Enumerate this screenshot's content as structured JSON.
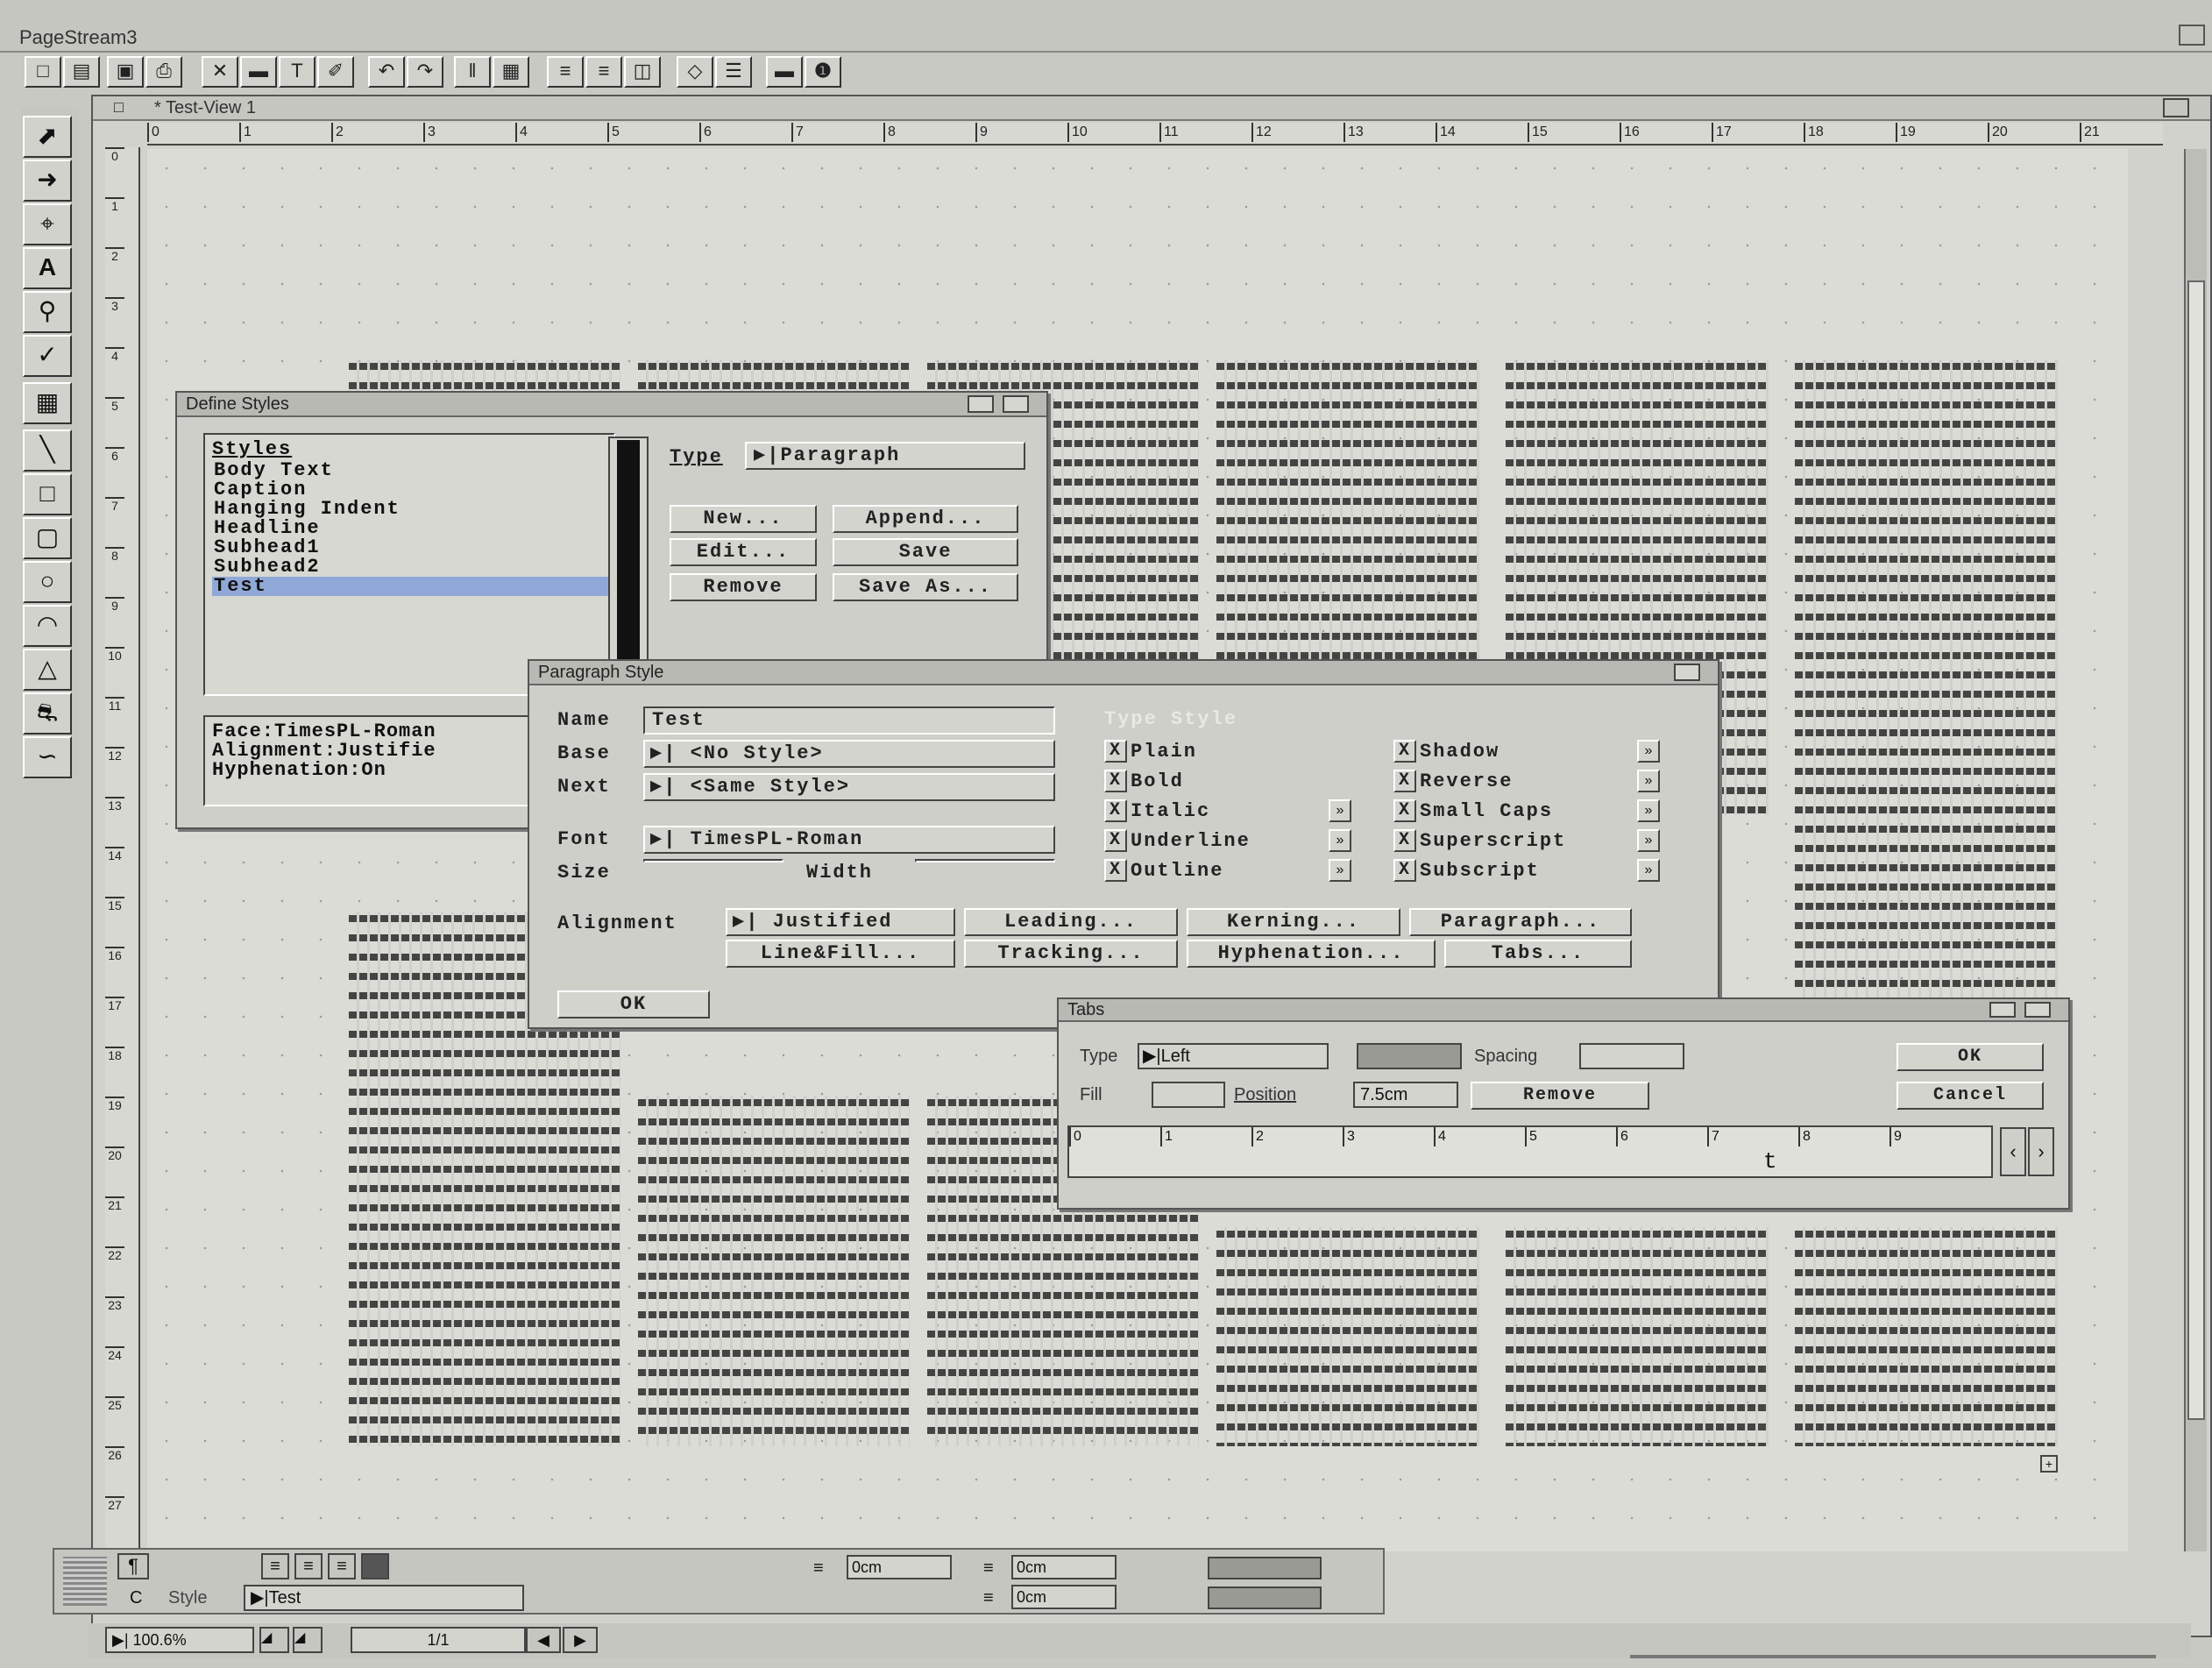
{
  "app": {
    "title": "PageStream3",
    "view_title": "* Test-View 1"
  },
  "toolbar": {
    "icons": [
      "new-document-icon",
      "open-icon",
      "save-icon",
      "print-icon",
      "cut-icon",
      "copy-icon",
      "paste-icon",
      "brush-icon",
      "undo-icon",
      "redo-icon",
      "columns-icon",
      "grid-icon",
      "align-left-icon",
      "align-center-icon",
      "align-right-icon",
      "select-icon",
      "list-icon",
      "minus-icon",
      "info-icon"
    ]
  },
  "tools": [
    "arrow-tool-icon",
    "node-tool-icon",
    "crop-tool-icon",
    "text-tool-icon",
    "zoom-tool-icon",
    "eyedropper-tool-icon",
    "column-tool-icon",
    "line-tool-icon",
    "rectangle-tool-icon",
    "rounded-rect-tool-icon",
    "ellipse-tool-icon",
    "arc-tool-icon",
    "polygon-tool-icon",
    "pen-tool-icon",
    "bezier-tool-icon"
  ],
  "ruler": {
    "h": [
      "0",
      "1",
      "2",
      "3",
      "4",
      "5",
      "6",
      "7",
      "8",
      "9",
      "10",
      "11",
      "12",
      "13",
      "14",
      "15",
      "16",
      "17",
      "18",
      "19",
      "20",
      "21"
    ],
    "v": [
      "0",
      "1",
      "2",
      "3",
      "4",
      "5",
      "6",
      "7",
      "8",
      "9",
      "10",
      "11",
      "12",
      "13",
      "14",
      "15",
      "16",
      "17",
      "18",
      "19",
      "20",
      "21",
      "22",
      "23",
      "24",
      "25",
      "26",
      "27"
    ]
  },
  "define_styles": {
    "title": "Define Styles",
    "list_header": "Styles",
    "styles": [
      "Body Text",
      "Caption",
      "Hanging Indent",
      "Headline",
      "Subhead1",
      "Subhead2",
      "Test"
    ],
    "selected": "Test",
    "type_label": "Type",
    "type_value": "Paragraph",
    "new": "New...",
    "append": "Append...",
    "edit": "Edit...",
    "save": "Save",
    "remove": "Remove",
    "save_as": "Save As...",
    "info": [
      "Face:TimesPL-Roman",
      "Alignment:Justifie",
      "Hyphenation:On"
    ]
  },
  "paragraph_style": {
    "title": "Paragraph Style",
    "name_label": "Name",
    "name_value": "Test",
    "base_label": "Base",
    "base_value": "<No Style>",
    "next_label": "Next",
    "next_value": "<Same Style>",
    "font_label": "Font",
    "font_value": "TimesPL-Roman",
    "size_label": "Size",
    "width_label": "Width",
    "type_style_header": "Type Style",
    "styles_left": [
      "Plain",
      "Bold",
      "Italic",
      "Underline",
      "Outline"
    ],
    "styles_right": [
      "Shadow",
      "Reverse",
      "Small Caps",
      "Superscript",
      "Subscript"
    ],
    "alignment_label": "Alignment",
    "alignment_value": "Justified",
    "leading": "Leading...",
    "kerning": "Kerning...",
    "paragraph": "Paragraph...",
    "linefill": "Line&Fill...",
    "tracking": "Tracking...",
    "hyphenation": "Hyphenation...",
    "tabs": "Tabs...",
    "ok": "OK"
  },
  "tabs": {
    "title": "Tabs",
    "type_label": "Type",
    "type_value": "Left",
    "spacing_label": "Spacing",
    "fill_label": "Fill",
    "position_label": "Position",
    "position_value": "7.5cm",
    "remove": "Remove",
    "ok": "OK",
    "cancel": "Cancel",
    "ruler": [
      "0",
      "1",
      "2",
      "3",
      "4",
      "5",
      "6",
      "7",
      "8",
      "9"
    ],
    "marker": "t"
  },
  "bottom": {
    "style_prefix": "C",
    "style_label": "Style",
    "style_value": "Test",
    "field1": "0cm",
    "field2": "0cm",
    "field3": "0cm",
    "zoom": "100.6%",
    "page": "1/1"
  }
}
